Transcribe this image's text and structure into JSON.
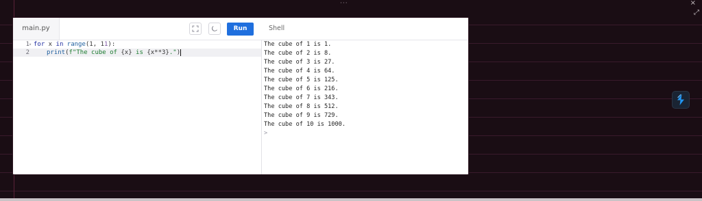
{
  "window": {
    "menu_dots": "···",
    "close_glyph": "×",
    "expand_glyph": "⤢"
  },
  "editor": {
    "file_tab": "main.py",
    "run_label": "Run",
    "shell_tab": "Shell",
    "icons": [
      "fullscreen-icon",
      "moon-icon"
    ],
    "lines": [
      {
        "number": "1",
        "text": "for x in range(1, 11):"
      },
      {
        "number": "2",
        "text": "print(f\"The cube of {x} is {x**3}.\")"
      }
    ]
  },
  "shell": {
    "output": [
      "The cube of 1 is 1.",
      "The cube of 2 is 8.",
      "The cube of 3 is 27.",
      "The cube of 4 is 64.",
      "The cube of 5 is 125.",
      "The cube of 6 is 216.",
      "The cube of 7 is 343.",
      "The cube of 8 is 512.",
      "The cube of 9 is 729.",
      "The cube of 10 is 1000."
    ],
    "prompt": ">"
  },
  "colors": {
    "run_button": "#1f6fde",
    "background": "#1a0d14",
    "app_icon": "#1e90ff"
  }
}
